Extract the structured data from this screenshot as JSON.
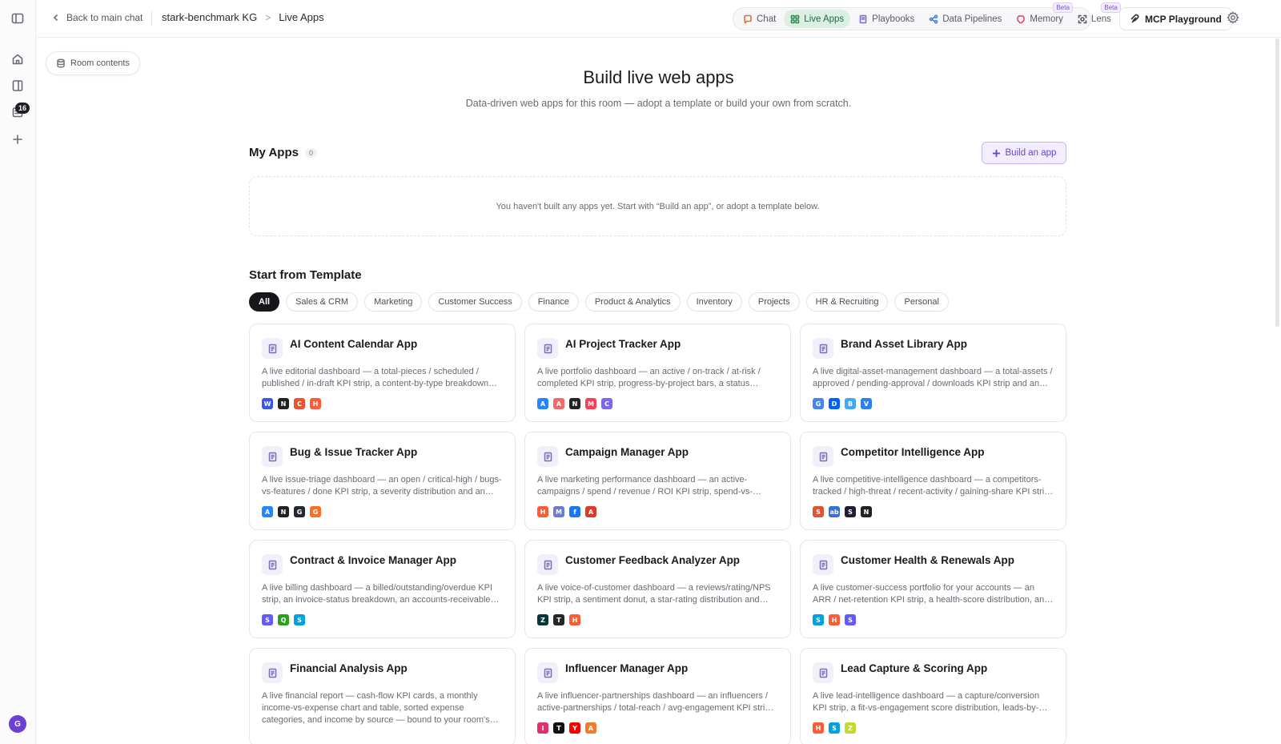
{
  "rail": {
    "badge": "16",
    "avatar_initial": "G"
  },
  "topbar": {
    "back_label": "Back to main chat",
    "breadcrumb": [
      "stark-benchmark KG",
      "Live Apps"
    ],
    "tabs": [
      {
        "label": "Chat",
        "icon": "chat-icon",
        "color": "#e0703a"
      },
      {
        "label": "Live Apps",
        "icon": "grid-icon",
        "color": "#2f8a52",
        "active": true
      },
      {
        "label": "Playbooks",
        "icon": "book-icon",
        "color": "#7a6fd0"
      },
      {
        "label": "Data Pipelines",
        "icon": "pipeline-icon",
        "color": "#4a7fd8"
      },
      {
        "label": "Memory",
        "icon": "brain-icon",
        "color": "#d8526e",
        "beta": "Beta"
      },
      {
        "label": "Lens",
        "icon": "lens-icon",
        "color": "#55555e",
        "beta": "Beta"
      }
    ],
    "mcp_label": "MCP Playground"
  },
  "room_contents_label": "Room contents",
  "hero": {
    "title": "Build live web apps",
    "subtitle": "Data-driven web apps for this room — adopt a template or build your own from scratch."
  },
  "my_apps": {
    "heading": "My Apps",
    "count": "0",
    "build_label": "Build an app",
    "empty_text": "You haven't built any apps yet. Start with “Build an app”, or adopt a template below."
  },
  "templates": {
    "heading": "Start from Template",
    "filters": [
      "All",
      "Sales & CRM",
      "Marketing",
      "Customer Success",
      "Finance",
      "Product & Analytics",
      "Inventory",
      "Projects",
      "HR & Recruiting",
      "Personal"
    ],
    "cards": [
      {
        "title": "AI Content Calendar App",
        "desc": "A live editorial dashboard — a total-pieces / scheduled / published / in-draft KPI strip, a content-by-type breakdown and a publishing calendar bound to your room's data.",
        "logos": [
          [
            "W",
            "#3858e9"
          ],
          [
            "N",
            "#222222"
          ],
          [
            "C",
            "#e8542f"
          ],
          [
            "H",
            "#ff5c35"
          ]
        ]
      },
      {
        "title": "AI Project Tracker App",
        "desc": "A live portfolio dashboard — an active / on-track / at-risk / completed KPI strip, progress-by-project bars, a status breakdown and upcoming milestones.",
        "logos": [
          [
            "A",
            "#2684ff"
          ],
          [
            "A",
            "#f06a6a"
          ],
          [
            "N",
            "#222222"
          ],
          [
            "M",
            "#ff3d57"
          ],
          [
            "C",
            "#7b68ee"
          ]
        ]
      },
      {
        "title": "Brand Asset Library App",
        "desc": "A live digital-asset-management dashboard — a total-assets / approved / pending-approval / downloads KPI strip and an asset gallery.",
        "logos": [
          [
            "G",
            "#4285f4"
          ],
          [
            "D",
            "#0061ff"
          ],
          [
            "B",
            "#3fa9f5"
          ],
          [
            "V",
            "#2d7ff9"
          ]
        ]
      },
      {
        "title": "Bug & Issue Tracker App",
        "desc": "A live issue-triage dashboard — an open / critical-high / bugs-vs-features / done KPI strip, a severity distribution and an issue list.",
        "logos": [
          [
            "A",
            "#2684ff"
          ],
          [
            "N",
            "#222222"
          ],
          [
            "G",
            "#24292f"
          ],
          [
            "G",
            "#fc6d26"
          ]
        ]
      },
      {
        "title": "Campaign Manager App",
        "desc": "A live marketing performance dashboard — an active-campaigns / spend / revenue / ROI KPI strip, spend-vs-revenue charts and a campaign table.",
        "logos": [
          [
            "H",
            "#ff5c35"
          ],
          [
            "M",
            "#6b7bd6"
          ],
          [
            "f",
            "#1877f2"
          ],
          [
            "A",
            "#e0392b"
          ]
        ]
      },
      {
        "title": "Competitor Intelligence App",
        "desc": "A live competitive-intelligence dashboard — a competitors-tracked / high-threat / recent-activity / gaining-share KPI strip and a competitor list.",
        "logos": [
          [
            "S",
            "#e0532f"
          ],
          [
            "ab",
            "#3a6fd8"
          ],
          [
            "S",
            "#1e1e3a"
          ],
          [
            "N",
            "#222222"
          ]
        ]
      },
      {
        "title": "Contract & Invoice Manager App",
        "desc": "A live billing dashboard — a billed/outstanding/overdue KPI strip, an invoice-status breakdown, an accounts-receivable aging view and an invoice list.",
        "logos": [
          [
            "S",
            "#635bff"
          ],
          [
            "Q",
            "#2ca01c"
          ],
          [
            "S",
            "#00a1e0"
          ]
        ]
      },
      {
        "title": "Customer Feedback Analyzer App",
        "desc": "A live voice-of-customer dashboard — a reviews/rating/NPS KPI strip, a sentiment donut, a star-rating distribution and recent feedback.",
        "logos": [
          [
            "Z",
            "#03363d"
          ],
          [
            "T",
            "#262627"
          ],
          [
            "H",
            "#ff5c35"
          ]
        ]
      },
      {
        "title": "Customer Health & Renewals App",
        "desc": "A live customer-success portfolio for your accounts — an ARR / net-retention KPI strip, a health-score distribution, and upcoming renewals.",
        "logos": [
          [
            "S",
            "#00a1e0"
          ],
          [
            "H",
            "#ff5c35"
          ],
          [
            "S",
            "#635bff"
          ]
        ]
      },
      {
        "title": "Financial Analysis App",
        "desc": "A live financial report — cash-flow KPI cards, a monthly income-vs-expense chart and table, sorted expense categories, and income by source — bound to your room's data.",
        "logos": [],
        "tall": true
      },
      {
        "title": "Influencer Manager App",
        "desc": "A live influencer-partnerships dashboard — an influencers / active-partnerships / total-reach / avg-engagement KPI strip and a creator roster.",
        "logos": [
          [
            "I",
            "#e1306c"
          ],
          [
            "T",
            "#111111"
          ],
          [
            "Y",
            "#ff0000"
          ],
          [
            "A",
            "#f47b2a"
          ]
        ]
      },
      {
        "title": "Lead Capture & Scoring App",
        "desc": "A live lead-intelligence dashboard — a capture/conversion KPI strip, a fit-vs-engagement score distribution, leads-by-source and a lead list.",
        "logos": [
          [
            "H",
            "#ff5c35"
          ],
          [
            "S",
            "#00a1e0"
          ],
          [
            "Z",
            "#c5d82b"
          ]
        ]
      }
    ]
  }
}
